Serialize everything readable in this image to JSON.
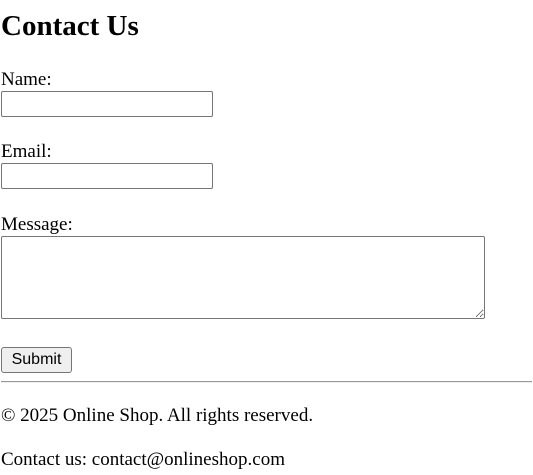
{
  "page": {
    "title": "Contact Us"
  },
  "form": {
    "name_label": "Name:",
    "name_value": "",
    "email_label": "Email:",
    "email_value": "",
    "message_label": "Message:",
    "message_value": "",
    "submit_label": "Submit"
  },
  "footer": {
    "copyright": "© 2025 Online Shop. All rights reserved.",
    "contact": "Contact us: contact@onlineshop.com"
  }
}
